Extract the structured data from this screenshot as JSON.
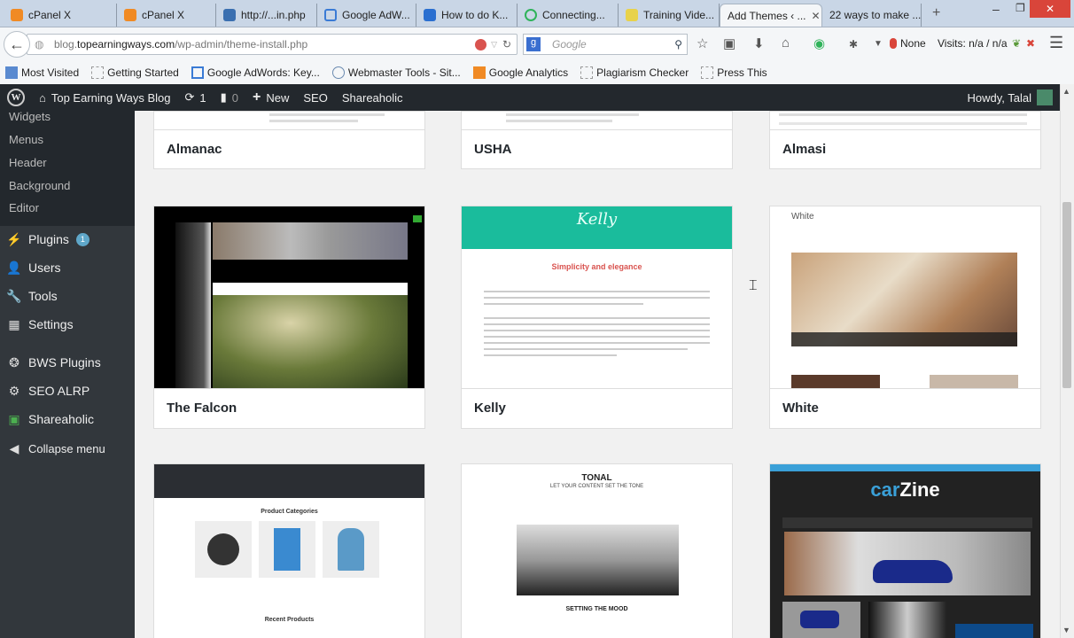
{
  "browser": {
    "tabs": [
      {
        "label": "cPanel X",
        "color": "#f08a24"
      },
      {
        "label": "cPanel X",
        "color": "#f08a24"
      },
      {
        "label": "http://...in.php",
        "color": "#3a6fb0"
      },
      {
        "label": "Google AdW...",
        "color": "#3a7bd5"
      },
      {
        "label": "How to do K...",
        "color": "#2a6fd0"
      },
      {
        "label": "Connecting...",
        "color": "#2fb35a"
      },
      {
        "label": "Training Vide...",
        "color": "#e8d24a"
      },
      {
        "label": "Add Themes ‹ ...",
        "color": ""
      },
      {
        "label": "22 ways to make ...",
        "color": ""
      }
    ],
    "new_tab": "+",
    "url_host": "blog.",
    "url_domain": "topearningways.com",
    "url_path": "/wp-admin/theme-install.php",
    "search_placeholder": "Google",
    "addon_none": "None",
    "addon_visits": "Visits: n/a / n/a",
    "bookmarks": [
      "Most Visited",
      "Getting Started",
      "Google AdWords: Key...",
      "Webmaster Tools - Sit...",
      "Google Analytics",
      "Plagiarism Checker",
      "Press This"
    ]
  },
  "adminbar": {
    "site": "Top Earning Ways Blog",
    "updates": "1",
    "comments": "0",
    "new": "New",
    "seo": "SEO",
    "shareaholic": "Shareaholic",
    "howdy": "Howdy, Talal"
  },
  "sidebar": {
    "submenu": [
      "Widgets",
      "Menus",
      "Header",
      "Background",
      "Editor"
    ],
    "items": [
      {
        "label": "Plugins",
        "icon": "plug-icon",
        "badge": "1"
      },
      {
        "label": "Users",
        "icon": "user-icon"
      },
      {
        "label": "Tools",
        "icon": "wrench-icon"
      },
      {
        "label": "Settings",
        "icon": "settings-icon"
      },
      {
        "label": "BWS Plugins",
        "icon": "bws-icon"
      },
      {
        "label": "SEO ALRP",
        "icon": "gear-icon"
      },
      {
        "label": "Shareaholic",
        "icon": "shareaholic-icon"
      },
      {
        "label": "Collapse menu",
        "icon": "collapse-icon"
      }
    ]
  },
  "themes": [
    {
      "name": "Almanac"
    },
    {
      "name": "USHA"
    },
    {
      "name": "Almasi"
    },
    {
      "name": "The Falcon"
    },
    {
      "name": "Kelly",
      "preview_title": "Kelly",
      "preview_heading": "Simplicity and elegance"
    },
    {
      "name": "White",
      "preview_title": "White"
    },
    {
      "name": "",
      "preview_heading": "Product Categories",
      "preview_sub": "Recent Products"
    },
    {
      "name": "",
      "preview_title": "TONAL",
      "preview_tagline": "LET YOUR CONTENT SET THE TONE",
      "preview_heading": "SETTING THE MOOD"
    },
    {
      "name": "",
      "preview_title_a": "car",
      "preview_title_b": "Zine"
    }
  ],
  "colors": {
    "accent": "#1abc9c",
    "admin": "#23282d",
    "sidebar": "#32373c"
  }
}
